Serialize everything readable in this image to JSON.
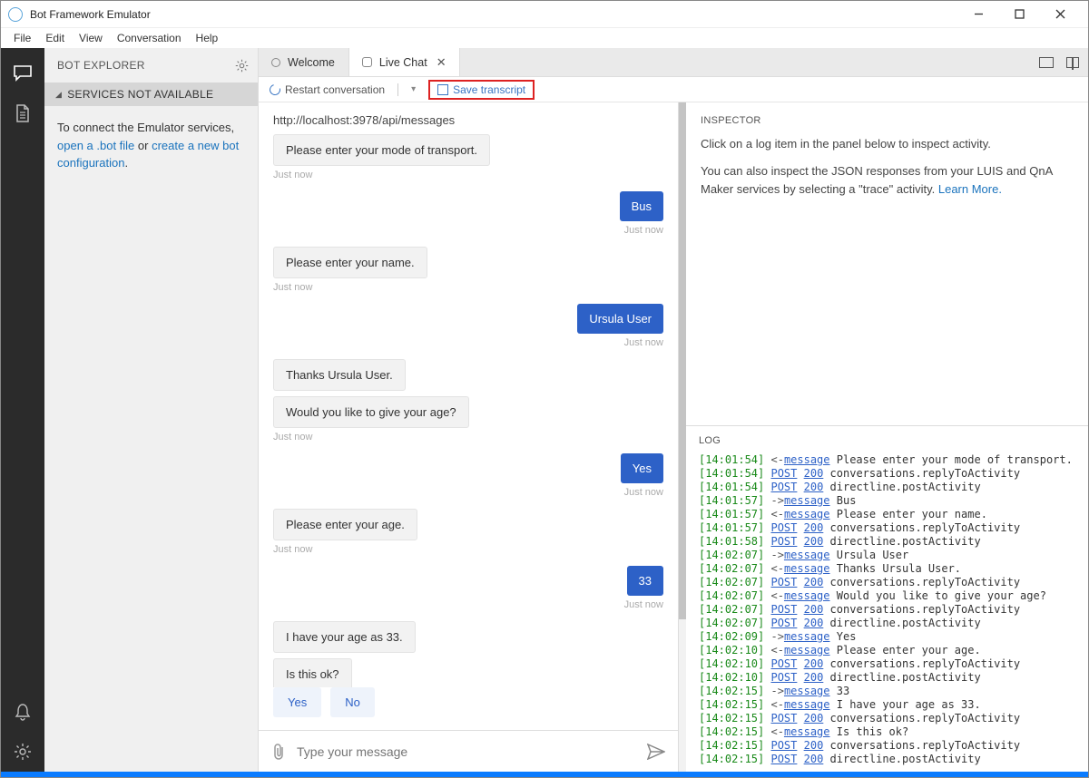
{
  "window": {
    "title": "Bot Framework Emulator"
  },
  "menubar": [
    "File",
    "Edit",
    "View",
    "Conversation",
    "Help"
  ],
  "explorer": {
    "header": "BOT EXPLORER",
    "section": "SERVICES NOT AVAILABLE",
    "connect_prefix": "To connect the Emulator services, ",
    "link_open": "open a .bot file",
    "connect_or": " or ",
    "link_create": "create a new bot configuration",
    "connect_suffix": "."
  },
  "tabs": {
    "welcome": "Welcome",
    "livechat": "Live Chat"
  },
  "toolbar": {
    "restart": "Restart conversation",
    "save": "Save transcript"
  },
  "chat": {
    "url": "http://localhost:3978/api/messages",
    "just_now": "Just now",
    "messages": [
      {
        "side": "bot",
        "text": "Please enter your mode of transport."
      },
      {
        "side": "user",
        "text": "Bus"
      },
      {
        "side": "bot",
        "text": "Please enter your name."
      },
      {
        "side": "user",
        "text": "Ursula User"
      },
      {
        "side": "bot",
        "text": "Thanks Ursula User."
      },
      {
        "side": "bot",
        "text": "Would you like to give your age?"
      },
      {
        "side": "user",
        "text": "Yes"
      },
      {
        "side": "bot",
        "text": "Please enter your age."
      },
      {
        "side": "user",
        "text": "33"
      },
      {
        "side": "bot",
        "text": "I have your age as 33."
      },
      {
        "side": "bot",
        "text": "Is this ok?"
      }
    ],
    "suggestions": [
      "Yes",
      "No"
    ],
    "placeholder": "Type your message"
  },
  "inspector": {
    "header": "INSPECTOR",
    "p1": "Click on a log item in the panel below to inspect activity.",
    "p2_a": "You can also inspect the JSON responses from your LUIS and QnA Maker services by selecting a \"trace\" activity. ",
    "learn_more": "Learn More."
  },
  "log": {
    "header": "LOG",
    "entries": [
      {
        "ts": "14:01:54",
        "dir": "<-",
        "kw": "message",
        "text": "Please enter your mode of transport."
      },
      {
        "ts": "14:01:54",
        "dir": "",
        "kw": "POST",
        "status": "200",
        "text": "conversations.replyToActivity"
      },
      {
        "ts": "14:01:54",
        "dir": "",
        "kw": "POST",
        "status": "200",
        "text": "directline.postActivity"
      },
      {
        "ts": "14:01:57",
        "dir": "->",
        "kw": "message",
        "text": "Bus"
      },
      {
        "ts": "14:01:57",
        "dir": "<-",
        "kw": "message",
        "text": "Please enter your name."
      },
      {
        "ts": "14:01:57",
        "dir": "",
        "kw": "POST",
        "status": "200",
        "text": "conversations.replyToActivity"
      },
      {
        "ts": "14:01:58",
        "dir": "",
        "kw": "POST",
        "status": "200",
        "text": "directline.postActivity"
      },
      {
        "ts": "14:02:07",
        "dir": "->",
        "kw": "message",
        "text": "Ursula User"
      },
      {
        "ts": "14:02:07",
        "dir": "<-",
        "kw": "message",
        "text": "Thanks Ursula User."
      },
      {
        "ts": "14:02:07",
        "dir": "",
        "kw": "POST",
        "status": "200",
        "text": "conversations.replyToActivity"
      },
      {
        "ts": "14:02:07",
        "dir": "<-",
        "kw": "message",
        "text": "Would you like to give your age?"
      },
      {
        "ts": "14:02:07",
        "dir": "",
        "kw": "POST",
        "status": "200",
        "text": "conversations.replyToActivity"
      },
      {
        "ts": "14:02:07",
        "dir": "",
        "kw": "POST",
        "status": "200",
        "text": "directline.postActivity"
      },
      {
        "ts": "14:02:09",
        "dir": "->",
        "kw": "message",
        "text": "Yes"
      },
      {
        "ts": "14:02:10",
        "dir": "<-",
        "kw": "message",
        "text": "Please enter your age."
      },
      {
        "ts": "14:02:10",
        "dir": "",
        "kw": "POST",
        "status": "200",
        "text": "conversations.replyToActivity"
      },
      {
        "ts": "14:02:10",
        "dir": "",
        "kw": "POST",
        "status": "200",
        "text": "directline.postActivity"
      },
      {
        "ts": "14:02:15",
        "dir": "->",
        "kw": "message",
        "text": "33"
      },
      {
        "ts": "14:02:15",
        "dir": "<-",
        "kw": "message",
        "text": "I have your age as 33."
      },
      {
        "ts": "14:02:15",
        "dir": "",
        "kw": "POST",
        "status": "200",
        "text": "conversations.replyToActivity"
      },
      {
        "ts": "14:02:15",
        "dir": "<-",
        "kw": "message",
        "text": "Is this ok?"
      },
      {
        "ts": "14:02:15",
        "dir": "",
        "kw": "POST",
        "status": "200",
        "text": "conversations.replyToActivity"
      },
      {
        "ts": "14:02:15",
        "dir": "",
        "kw": "POST",
        "status": "200",
        "text": "directline.postActivity"
      }
    ]
  }
}
